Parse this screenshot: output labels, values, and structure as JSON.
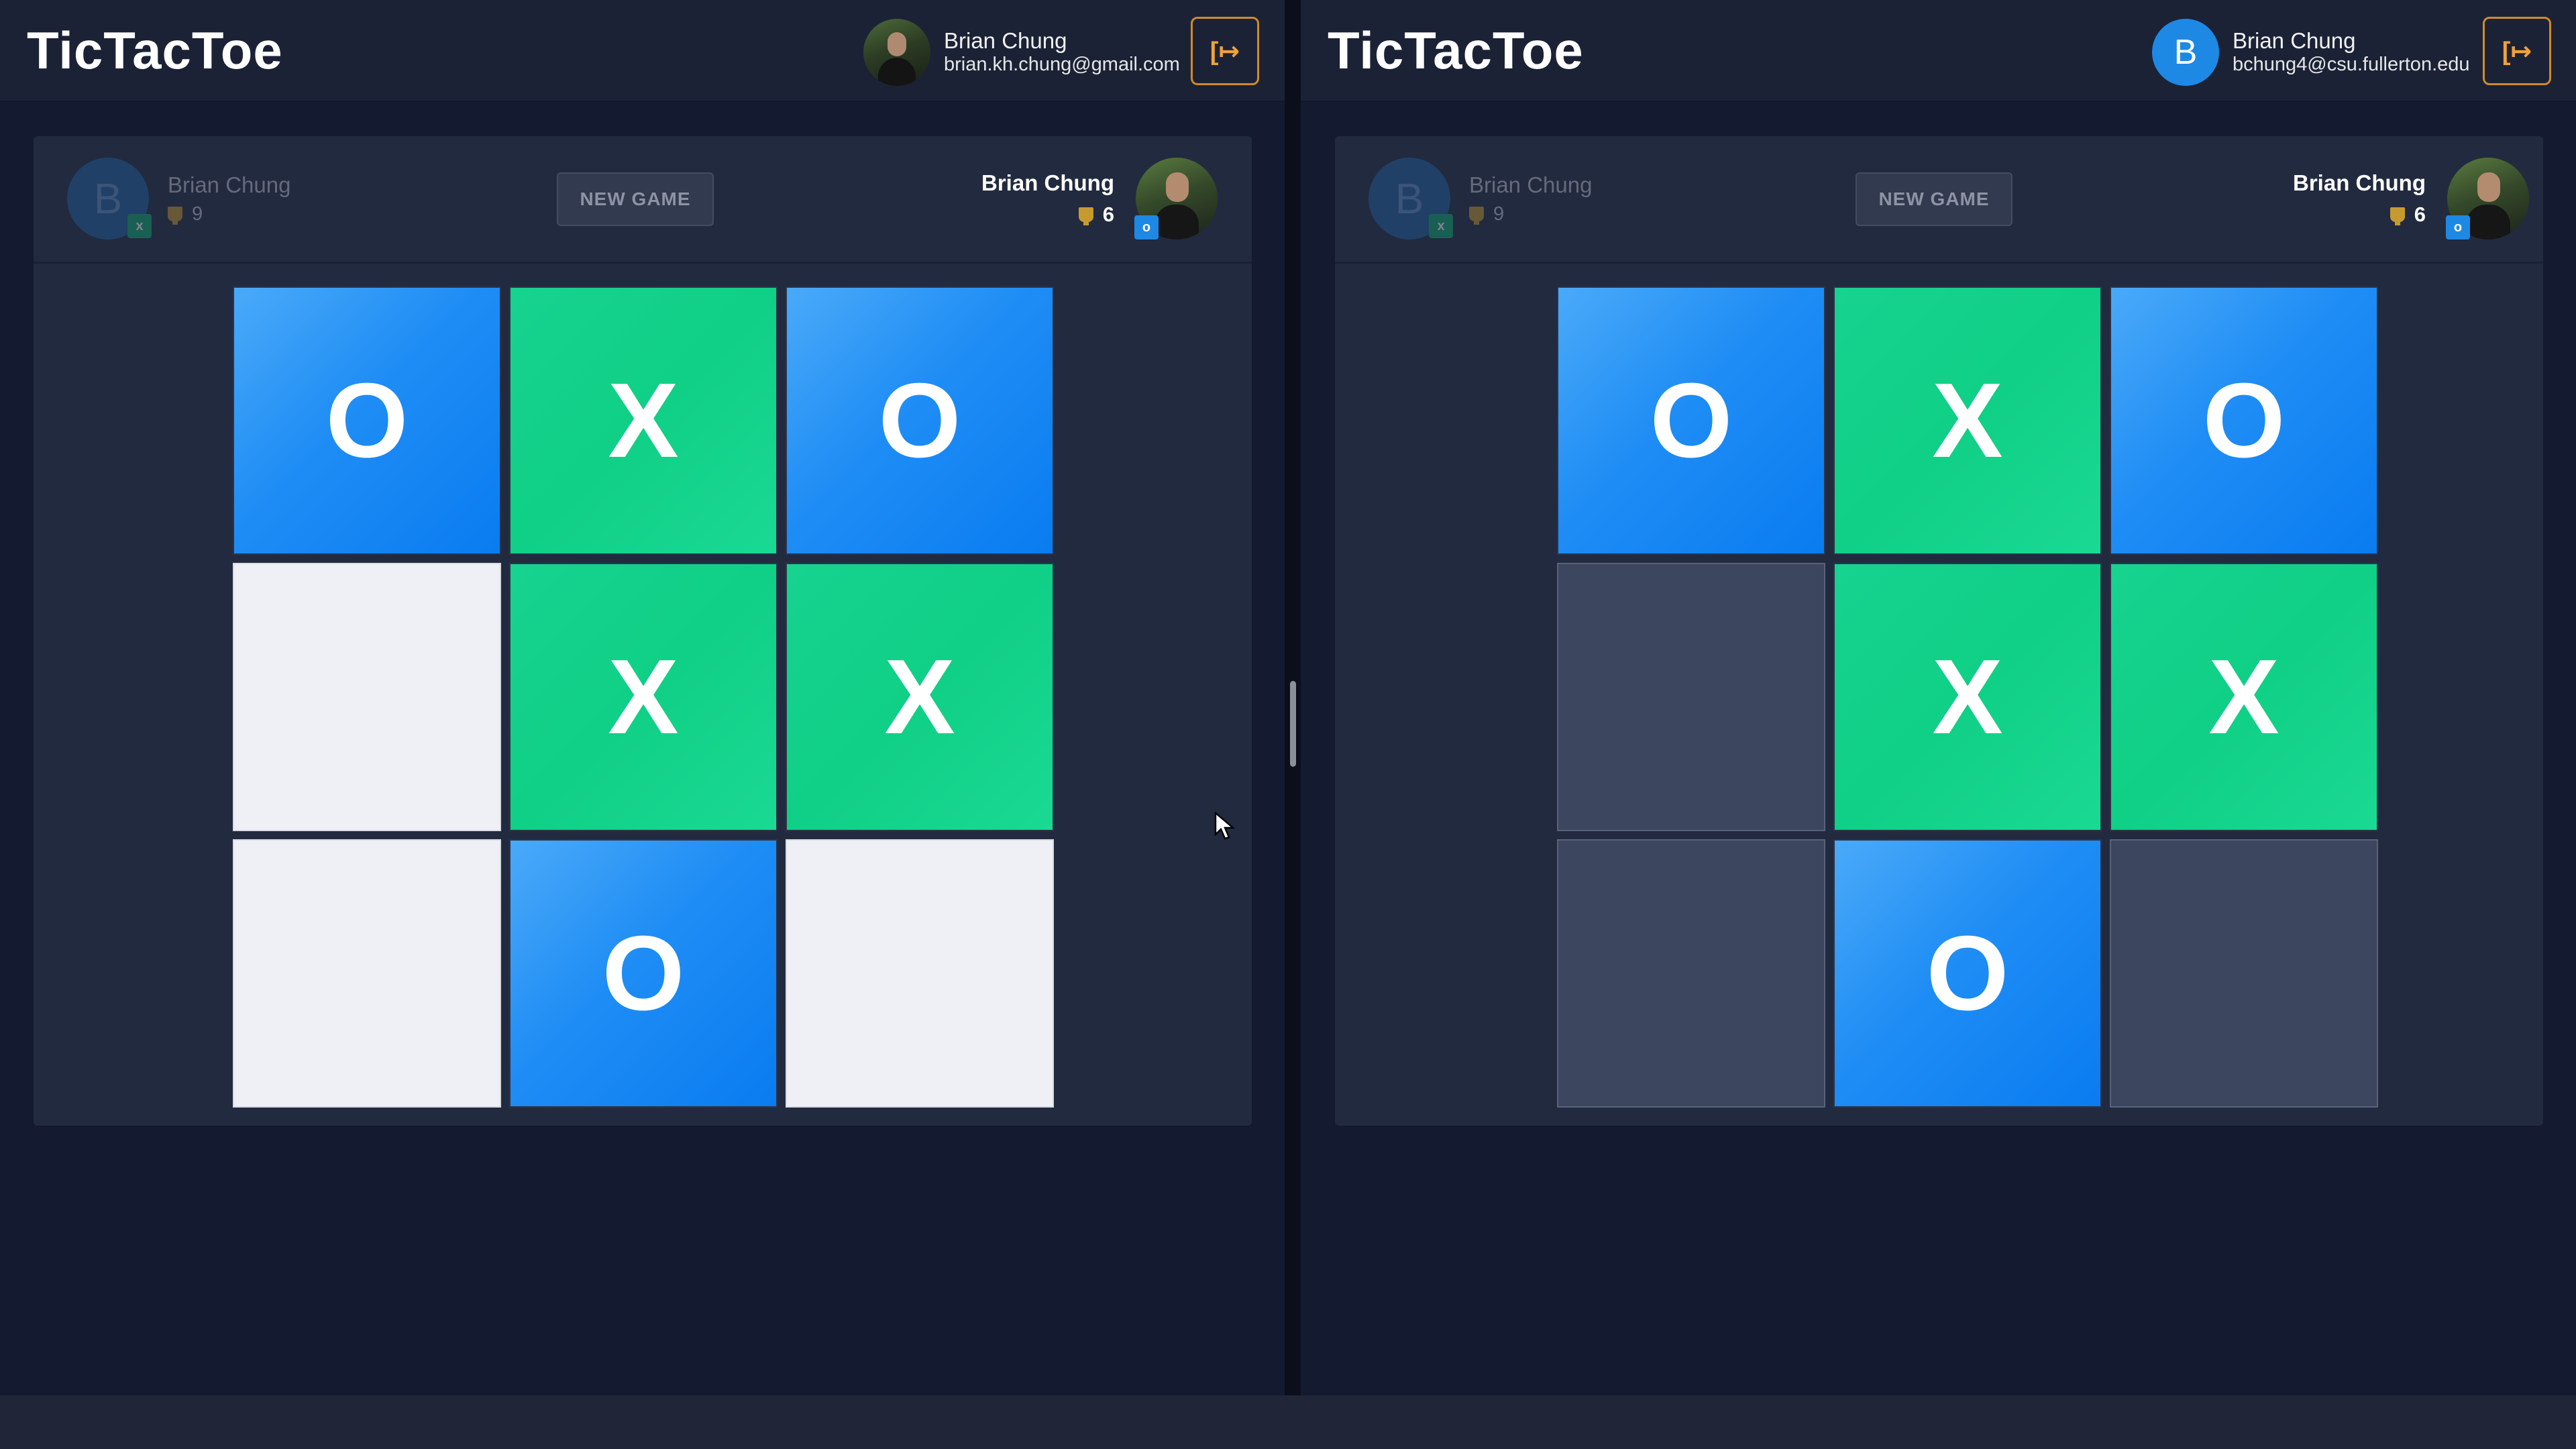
{
  "app_title": "TicTacToe",
  "panes": [
    {
      "user": {
        "name": "Brian Chung",
        "email": "brian.kh.chung@gmail.com",
        "avatar": "photo"
      },
      "logout_icon": "logout-icon",
      "opponent": {
        "avatar_letter": "B",
        "name": "Brian Chung",
        "score": "9",
        "mark": "x"
      },
      "new_game_label": "NEW GAME",
      "me": {
        "name": "Brian Chung",
        "score": "6",
        "mark": "o"
      },
      "board": [
        "O",
        "X",
        "O",
        "",
        "X",
        "X",
        "",
        "O",
        ""
      ],
      "empty_style": "light"
    },
    {
      "user": {
        "name": "Brian Chung",
        "email": "bchung4@csu.fullerton.edu",
        "avatar_letter": "B"
      },
      "logout_icon": "logout-icon",
      "opponent": {
        "avatar_letter": "B",
        "name": "Brian Chung",
        "score": "9",
        "mark": "x"
      },
      "new_game_label": "NEW GAME",
      "me": {
        "name": "Brian Chung",
        "score": "6",
        "mark": "o"
      },
      "board": [
        "O",
        "X",
        "O",
        "",
        "X",
        "X",
        "",
        "O",
        ""
      ],
      "empty_style": "dark"
    }
  ],
  "colors": {
    "o_cell": "#1f8df5",
    "x_cell": "#10cf86",
    "accent_logout": "#d08a2a",
    "background": "#141b30"
  }
}
